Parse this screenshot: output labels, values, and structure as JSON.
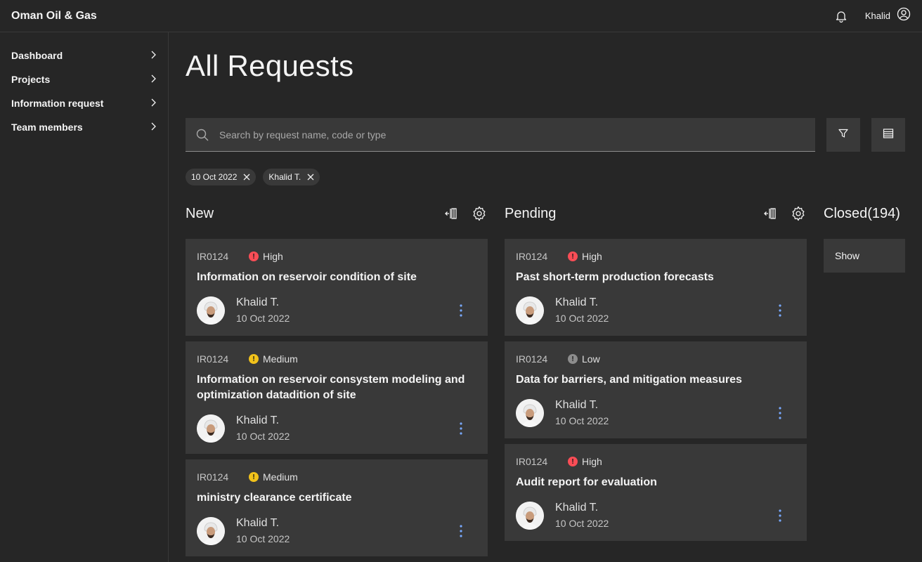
{
  "app": {
    "title": "Oman Oil & Gas"
  },
  "header": {
    "user_name": "Khalid",
    "bell_icon": "notification-icon",
    "user_icon": "user-avatar-icon"
  },
  "sidebar": {
    "items": [
      {
        "label": "Dashboard"
      },
      {
        "label": "Projects"
      },
      {
        "label": "Information request"
      },
      {
        "label": "Team members"
      }
    ]
  },
  "page": {
    "title": "All Requests"
  },
  "search": {
    "placeholder": "Search by request name, code or type",
    "value": ""
  },
  "filters": [
    {
      "label": "10 Oct 2022"
    },
    {
      "label": "Khalid T."
    }
  ],
  "colors": {
    "high": "#fa4d56",
    "medium": "#f1c21b",
    "low": "#8d8d8d",
    "overflow": "#78a9ff"
  },
  "columns": {
    "new": {
      "title": "New",
      "cards": [
        {
          "code": "IR0124",
          "priority": "High",
          "title": "Information on reservoir condition of site",
          "person": "Khalid T.",
          "date": "10 Oct 2022"
        },
        {
          "code": "IR0124",
          "priority": "Medium",
          "title": "Information on reservoir consystem modeling and optimization datadition of site",
          "person": "Khalid T.",
          "date": "10 Oct 2022"
        },
        {
          "code": "IR0124",
          "priority": "Medium",
          "title": "ministry clearance certificate",
          "person": "Khalid T.",
          "date": "10 Oct 2022"
        }
      ]
    },
    "pending": {
      "title": "Pending",
      "cards": [
        {
          "code": "IR0124",
          "priority": "High",
          "title": "Past short-term production forecasts",
          "person": "Khalid T.",
          "date": "10 Oct 2022"
        },
        {
          "code": "IR0124",
          "priority": "Low",
          "title": "Data for barriers, and mitigation measures",
          "person": "Khalid T.",
          "date": "10 Oct 2022"
        },
        {
          "code": "IR0124",
          "priority": "High",
          "title": "Audit report for evaluation",
          "person": "Khalid T.",
          "date": "10 Oct 2022"
        }
      ]
    },
    "closed": {
      "title": "Closed(194)",
      "show_label": "Show"
    }
  }
}
